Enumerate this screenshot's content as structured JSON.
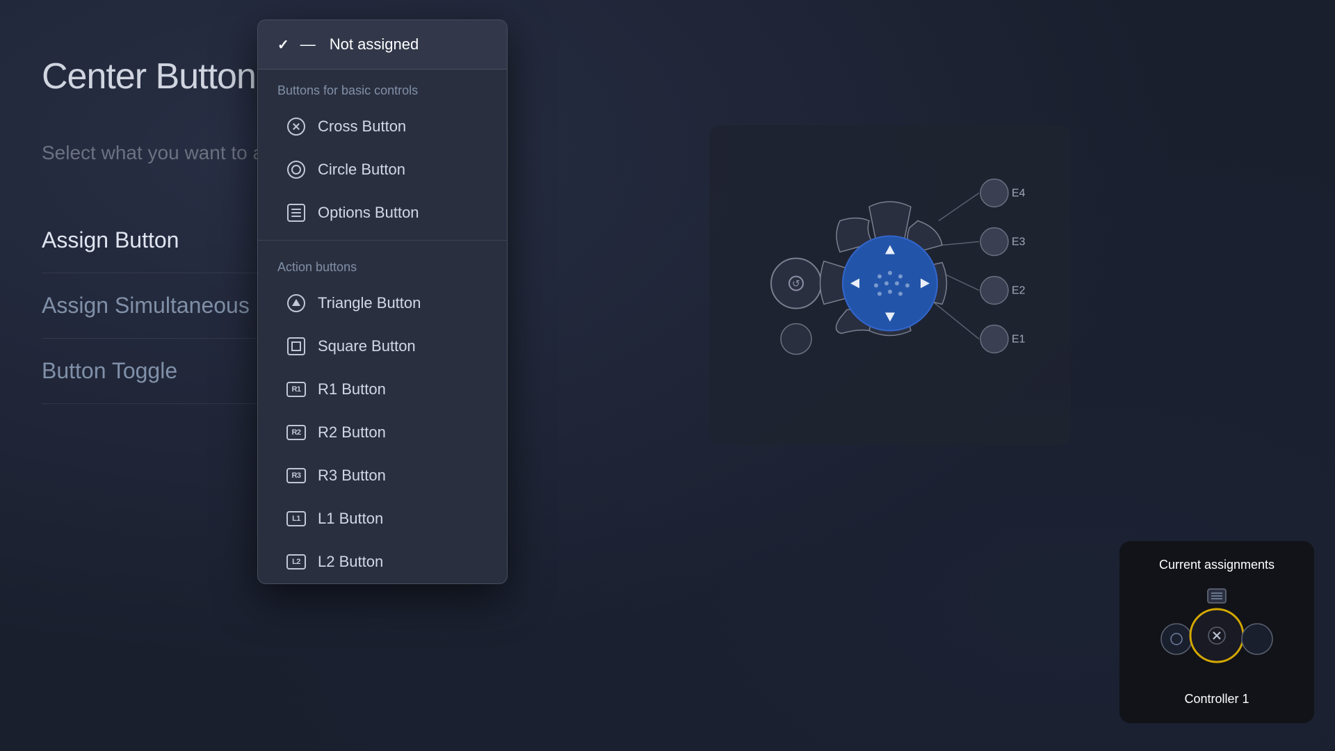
{
  "page": {
    "title": "Center Button",
    "subtitle": "Select what you want to a",
    "background_color": "#1a1f2e"
  },
  "menu": {
    "items": [
      {
        "id": "assign-button",
        "label": "Assign Button",
        "active": true
      },
      {
        "id": "assign-simultaneous",
        "label": "Assign Simultaneous Pre",
        "active": false
      },
      {
        "id": "button-toggle",
        "label": "Button Toggle",
        "active": false
      }
    ]
  },
  "dropdown": {
    "selected": {
      "check": "✓",
      "dash": "—",
      "label": "Not assigned"
    },
    "sections": [
      {
        "id": "basic-controls",
        "header": "Buttons for basic controls",
        "items": [
          {
            "id": "cross",
            "label": "Cross Button",
            "icon": "cross"
          },
          {
            "id": "circle",
            "label": "Circle Button",
            "icon": "circle"
          },
          {
            "id": "options",
            "label": "Options Button",
            "icon": "options"
          }
        ]
      },
      {
        "id": "action-buttons",
        "header": "Action buttons",
        "items": [
          {
            "id": "triangle",
            "label": "Triangle Button",
            "icon": "triangle"
          },
          {
            "id": "square",
            "label": "Square Button",
            "icon": "square"
          },
          {
            "id": "r1",
            "label": "R1 Button",
            "icon": "R1"
          },
          {
            "id": "r2",
            "label": "R2 Button",
            "icon": "R2"
          },
          {
            "id": "r3",
            "label": "R3 Button",
            "icon": "R3"
          },
          {
            "id": "l1",
            "label": "L1 Button",
            "icon": "L1"
          },
          {
            "id": "l2",
            "label": "L2 Button",
            "icon": "L2"
          }
        ]
      }
    ]
  },
  "assignments_panel": {
    "title": "Current assignments",
    "controller_label": "Controller 1"
  },
  "controller": {
    "e_labels": [
      "E1",
      "E2",
      "E3",
      "E4"
    ]
  }
}
